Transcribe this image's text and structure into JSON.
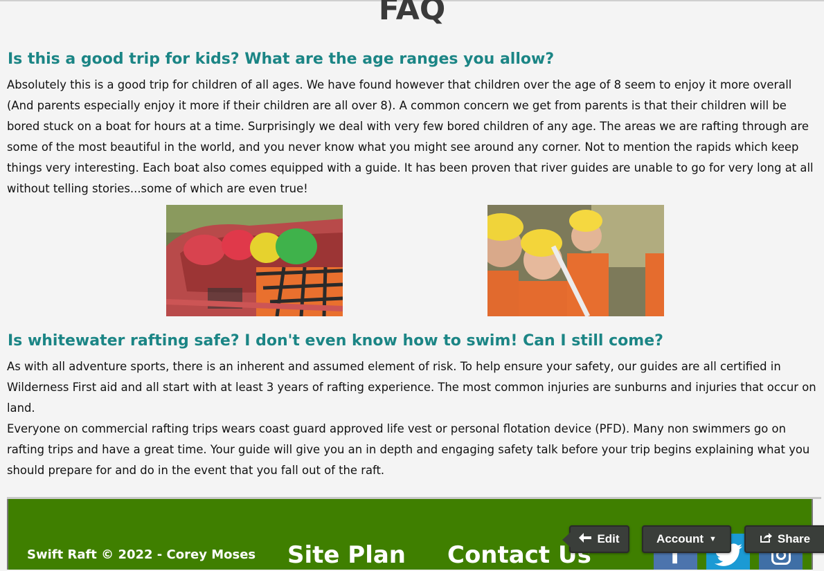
{
  "page": {
    "title": "FAQ"
  },
  "faqs": [
    {
      "question": "Is this a good trip for kids? What are the age ranges you allow?",
      "answer": "Absolutely this is a good trip for children of all ages. We have found however that children over the age of 8 seem to enjoy it more overall (And parents especially enjoy it more if their children are all over 8). A common concern we get from parents is that their children will be bored stuck on a boat for hours at a time. Surprisingly we deal with very few bored children of any age. The areas we are rafting through are some of the most beautiful in the world, and you never know what you might see around any corner. Not to mention the rapids which keep things very interesting. Each boat also comes equipped with a guide. It has been proven that river guides are unable to go for very long at all without telling stories...some of which are even true!"
    },
    {
      "question": "Is whitewater rafting safe? I don't even know how to swim! Can I still come?",
      "answer": "As with all adventure sports, there is an inherent and assumed element of risk. To help ensure your safety, our guides are all certified in Wilderness First aid and all start with at least 3 years of rafting experience. The most common injuries are sunburns and injuries that occur on land.",
      "answer2": "Everyone on commercial rafting trips wears coast guard approved life vest or personal flotation device (PFD). Many non swimmers go on rafting trips and have a great time. Your guide will give you an in depth and engaging safety talk before your trip begins explaining what you should prepare for and do in the event that you fall out of the raft."
    }
  ],
  "footer": {
    "copyright": "Swift Raft © 2022 - Corey Moses",
    "site_plan": "Site Plan",
    "contact_us": "Contact Us",
    "social": {
      "facebook_icon": "f",
      "twitter_icon": "twitter-bird",
      "instagram_icon": "camera"
    }
  },
  "admin_bar": {
    "edit": "Edit",
    "account": "Account",
    "share": "Share"
  },
  "colors": {
    "question": "#1b8585",
    "footer_bg": "#3f7f00",
    "admin_btn": "#3a3e3a"
  }
}
